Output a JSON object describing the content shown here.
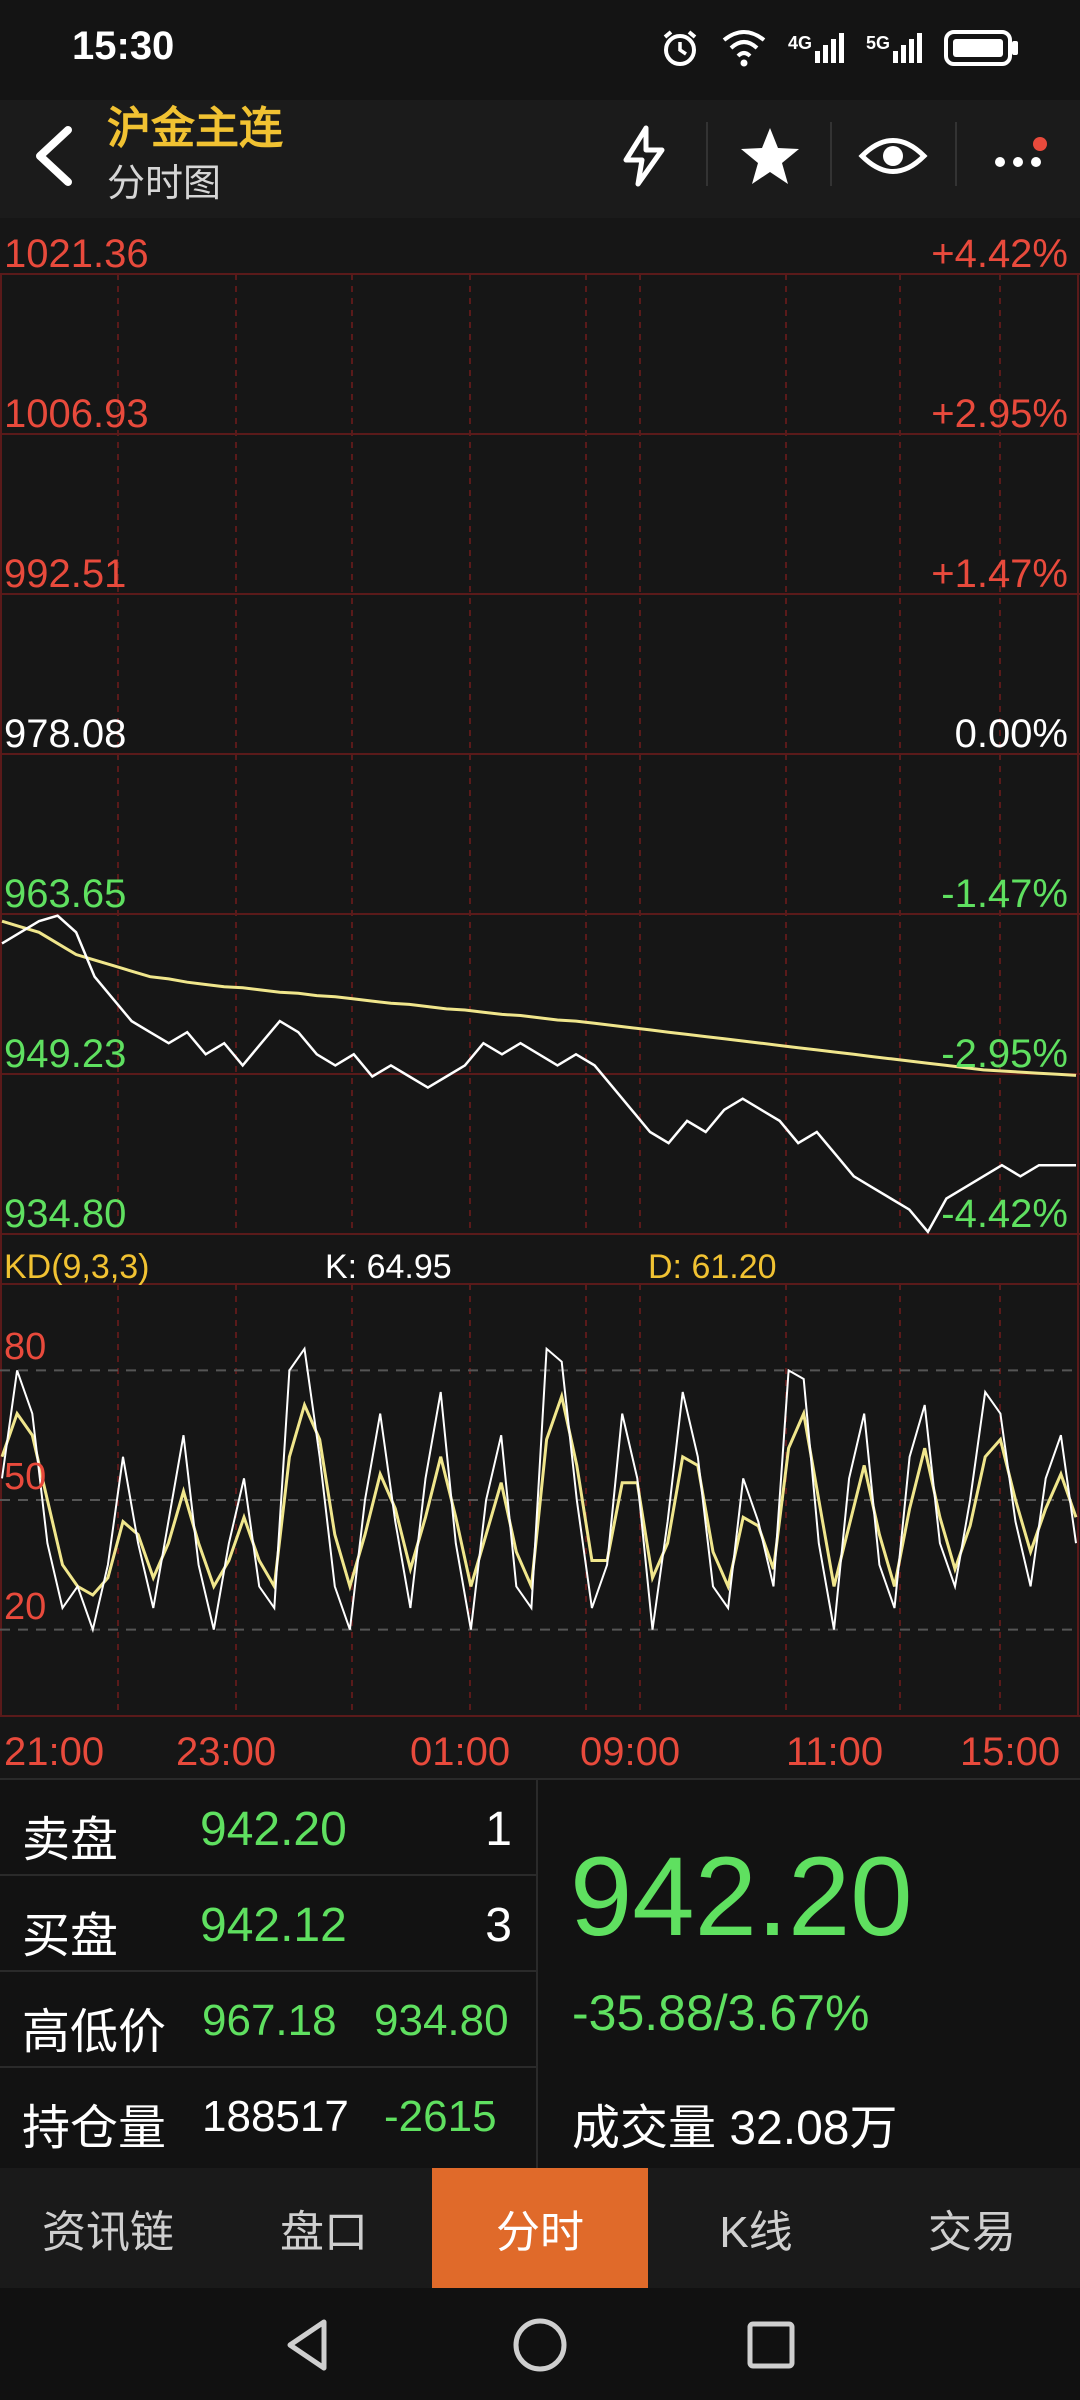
{
  "status": {
    "time": "15:30",
    "network_1": "4G",
    "network_2": "5G"
  },
  "header": {
    "title": "沪金主连",
    "subtitle": "分时图"
  },
  "price_levels": [
    "1021.36",
    "1006.93",
    "992.51",
    "978.08",
    "963.65",
    "949.23",
    "934.80"
  ],
  "pct_levels": [
    "+4.42%",
    "+2.95%",
    "+1.47%",
    "0.00%",
    "-1.47%",
    "-2.95%",
    "-4.42%"
  ],
  "kd": {
    "label": "KD(9,3,3)",
    "k": "K: 64.95",
    "d": "D: 61.20",
    "levels": [
      "80",
      "50",
      "20"
    ]
  },
  "time_axis": [
    "21:00",
    "23:00",
    "01:00",
    "09:00",
    "11:00",
    "15:00"
  ],
  "colors": {
    "up": "#e84a3c",
    "down": "#5fe060",
    "avg_line": "#f0e68c",
    "price_line": "#ffffff",
    "accent": "#e06a2a",
    "title": "#f1c232"
  },
  "chart_data": {
    "type": "line",
    "price_series": [
      961,
      962,
      963,
      963.5,
      962,
      958,
      956,
      954,
      953,
      952,
      953,
      951,
      952,
      950,
      952,
      954,
      953,
      951,
      950,
      951,
      949,
      950,
      949,
      948,
      949,
      950,
      952,
      951,
      952,
      951,
      950,
      951,
      950,
      948,
      946,
      944,
      943,
      945,
      944,
      946,
      947,
      946,
      945,
      943,
      944,
      942,
      940,
      939,
      938,
      937,
      935,
      938,
      939,
      940,
      941,
      940,
      941,
      941,
      941
    ],
    "avg_series": [
      963,
      962.5,
      962,
      961,
      960,
      959.5,
      959,
      958.5,
      958,
      957.8,
      957.5,
      957.3,
      957.1,
      957,
      956.8,
      956.6,
      956.5,
      956.3,
      956.2,
      956,
      955.8,
      955.6,
      955.5,
      955.3,
      955.1,
      955,
      954.8,
      954.6,
      954.5,
      954.3,
      954.1,
      954,
      953.8,
      953.6,
      953.4,
      953.2,
      953,
      952.8,
      952.6,
      952.4,
      952.2,
      952,
      951.8,
      951.6,
      951.4,
      951.2,
      951,
      950.8,
      950.6,
      950.4,
      950.2,
      950,
      949.8,
      949.6,
      949.5,
      949.4,
      949.3,
      949.2,
      949.1
    ],
    "ylim": [
      934.8,
      1021.36
    ],
    "k_series": [
      55,
      80,
      70,
      40,
      25,
      30,
      20,
      35,
      60,
      40,
      25,
      45,
      65,
      35,
      20,
      40,
      55,
      30,
      25,
      80,
      85,
      60,
      30,
      20,
      50,
      70,
      45,
      25,
      55,
      75,
      40,
      20,
      50,
      65,
      30,
      25,
      85,
      82,
      50,
      25,
      35,
      70,
      55,
      20,
      45,
      75,
      60,
      30,
      25,
      55,
      45,
      30,
      80,
      78,
      40,
      20,
      55,
      70,
      35,
      25,
      60,
      72,
      40,
      30,
      50,
      75,
      70,
      45,
      30,
      55,
      65,
      40
    ],
    "d_series": [
      60,
      70,
      65,
      50,
      35,
      30,
      28,
      32,
      45,
      42,
      32,
      40,
      52,
      40,
      30,
      36,
      46,
      36,
      30,
      60,
      72,
      64,
      42,
      30,
      42,
      56,
      48,
      34,
      46,
      60,
      46,
      30,
      42,
      54,
      38,
      30,
      64,
      74,
      58,
      36,
      36,
      54,
      54,
      32,
      40,
      60,
      58,
      38,
      30,
      46,
      44,
      34,
      62,
      70,
      50,
      30,
      44,
      58,
      42,
      30,
      48,
      62,
      46,
      34,
      44,
      60,
      64,
      50,
      38,
      48,
      56,
      46
    ]
  },
  "quote": {
    "rows": [
      {
        "key": "卖盘",
        "val": "942.20",
        "vol": "1"
      },
      {
        "key": "买盘",
        "val": "942.12",
        "vol": "3"
      },
      {
        "key": "高低价",
        "val": "967.18",
        "val2": "934.80"
      },
      {
        "key": "持仓量",
        "val": "188517",
        "val2": "-2615"
      }
    ],
    "last_price": "942.20",
    "change": "-35.88/3.67%",
    "volume_label": "成交量",
    "volume": "32.08万"
  },
  "tabs": [
    "资讯链",
    "盘口",
    "分时",
    "K线",
    "交易"
  ]
}
